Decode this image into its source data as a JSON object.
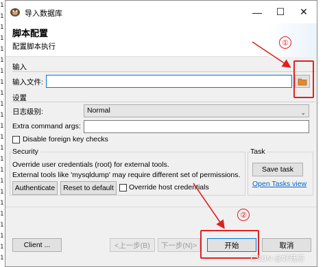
{
  "background": {
    "left_text_lines": [
      "1",
      "1",
      "1",
      "1",
      "1",
      "1",
      "1",
      "1",
      "1",
      "1",
      "1",
      "1",
      "1",
      "1",
      "1",
      "1",
      "1",
      "1",
      "1",
      "1",
      "1",
      "1",
      "1",
      "1"
    ]
  },
  "window": {
    "title": "导入数据库",
    "controls": {
      "minimize": "—",
      "maximize": "☐",
      "close": "✕"
    }
  },
  "header": {
    "title": "脚本配置",
    "subtitle": "配置脚本执行"
  },
  "input_section": {
    "label": "输入",
    "file_label": "输入文件:",
    "file_value": ""
  },
  "settings_section": {
    "label": "设置",
    "log_level_label": "日志级别:",
    "log_level_value": "Normal",
    "extra_args_label": "Extra command args:",
    "extra_args_value": "",
    "disable_fk_label": "Disable foreign key checks",
    "disable_fk_checked": false
  },
  "security_section": {
    "label": "Security",
    "line1": "Override user credentials (root) for external tools.",
    "line2": "External tools like 'mysqldump' may require different set of permissions.",
    "authenticate_label": "Authenticate",
    "reset_label": "Reset to default",
    "override_label": "Override host credentials",
    "override_checked": false
  },
  "task_section": {
    "label": "Task",
    "save_task_label": "Save task",
    "open_tasks_label": "Open Tasks view"
  },
  "footer": {
    "client_label": "Client ...",
    "back_label": "<上一步(B)",
    "next_label": "下一步(N)>",
    "start_label": "开始",
    "cancel_label": "取消"
  },
  "annotations": {
    "badge1": "①",
    "badge2": "②",
    "color": "#e02020"
  },
  "watermark": "CSDN @好菇凉"
}
